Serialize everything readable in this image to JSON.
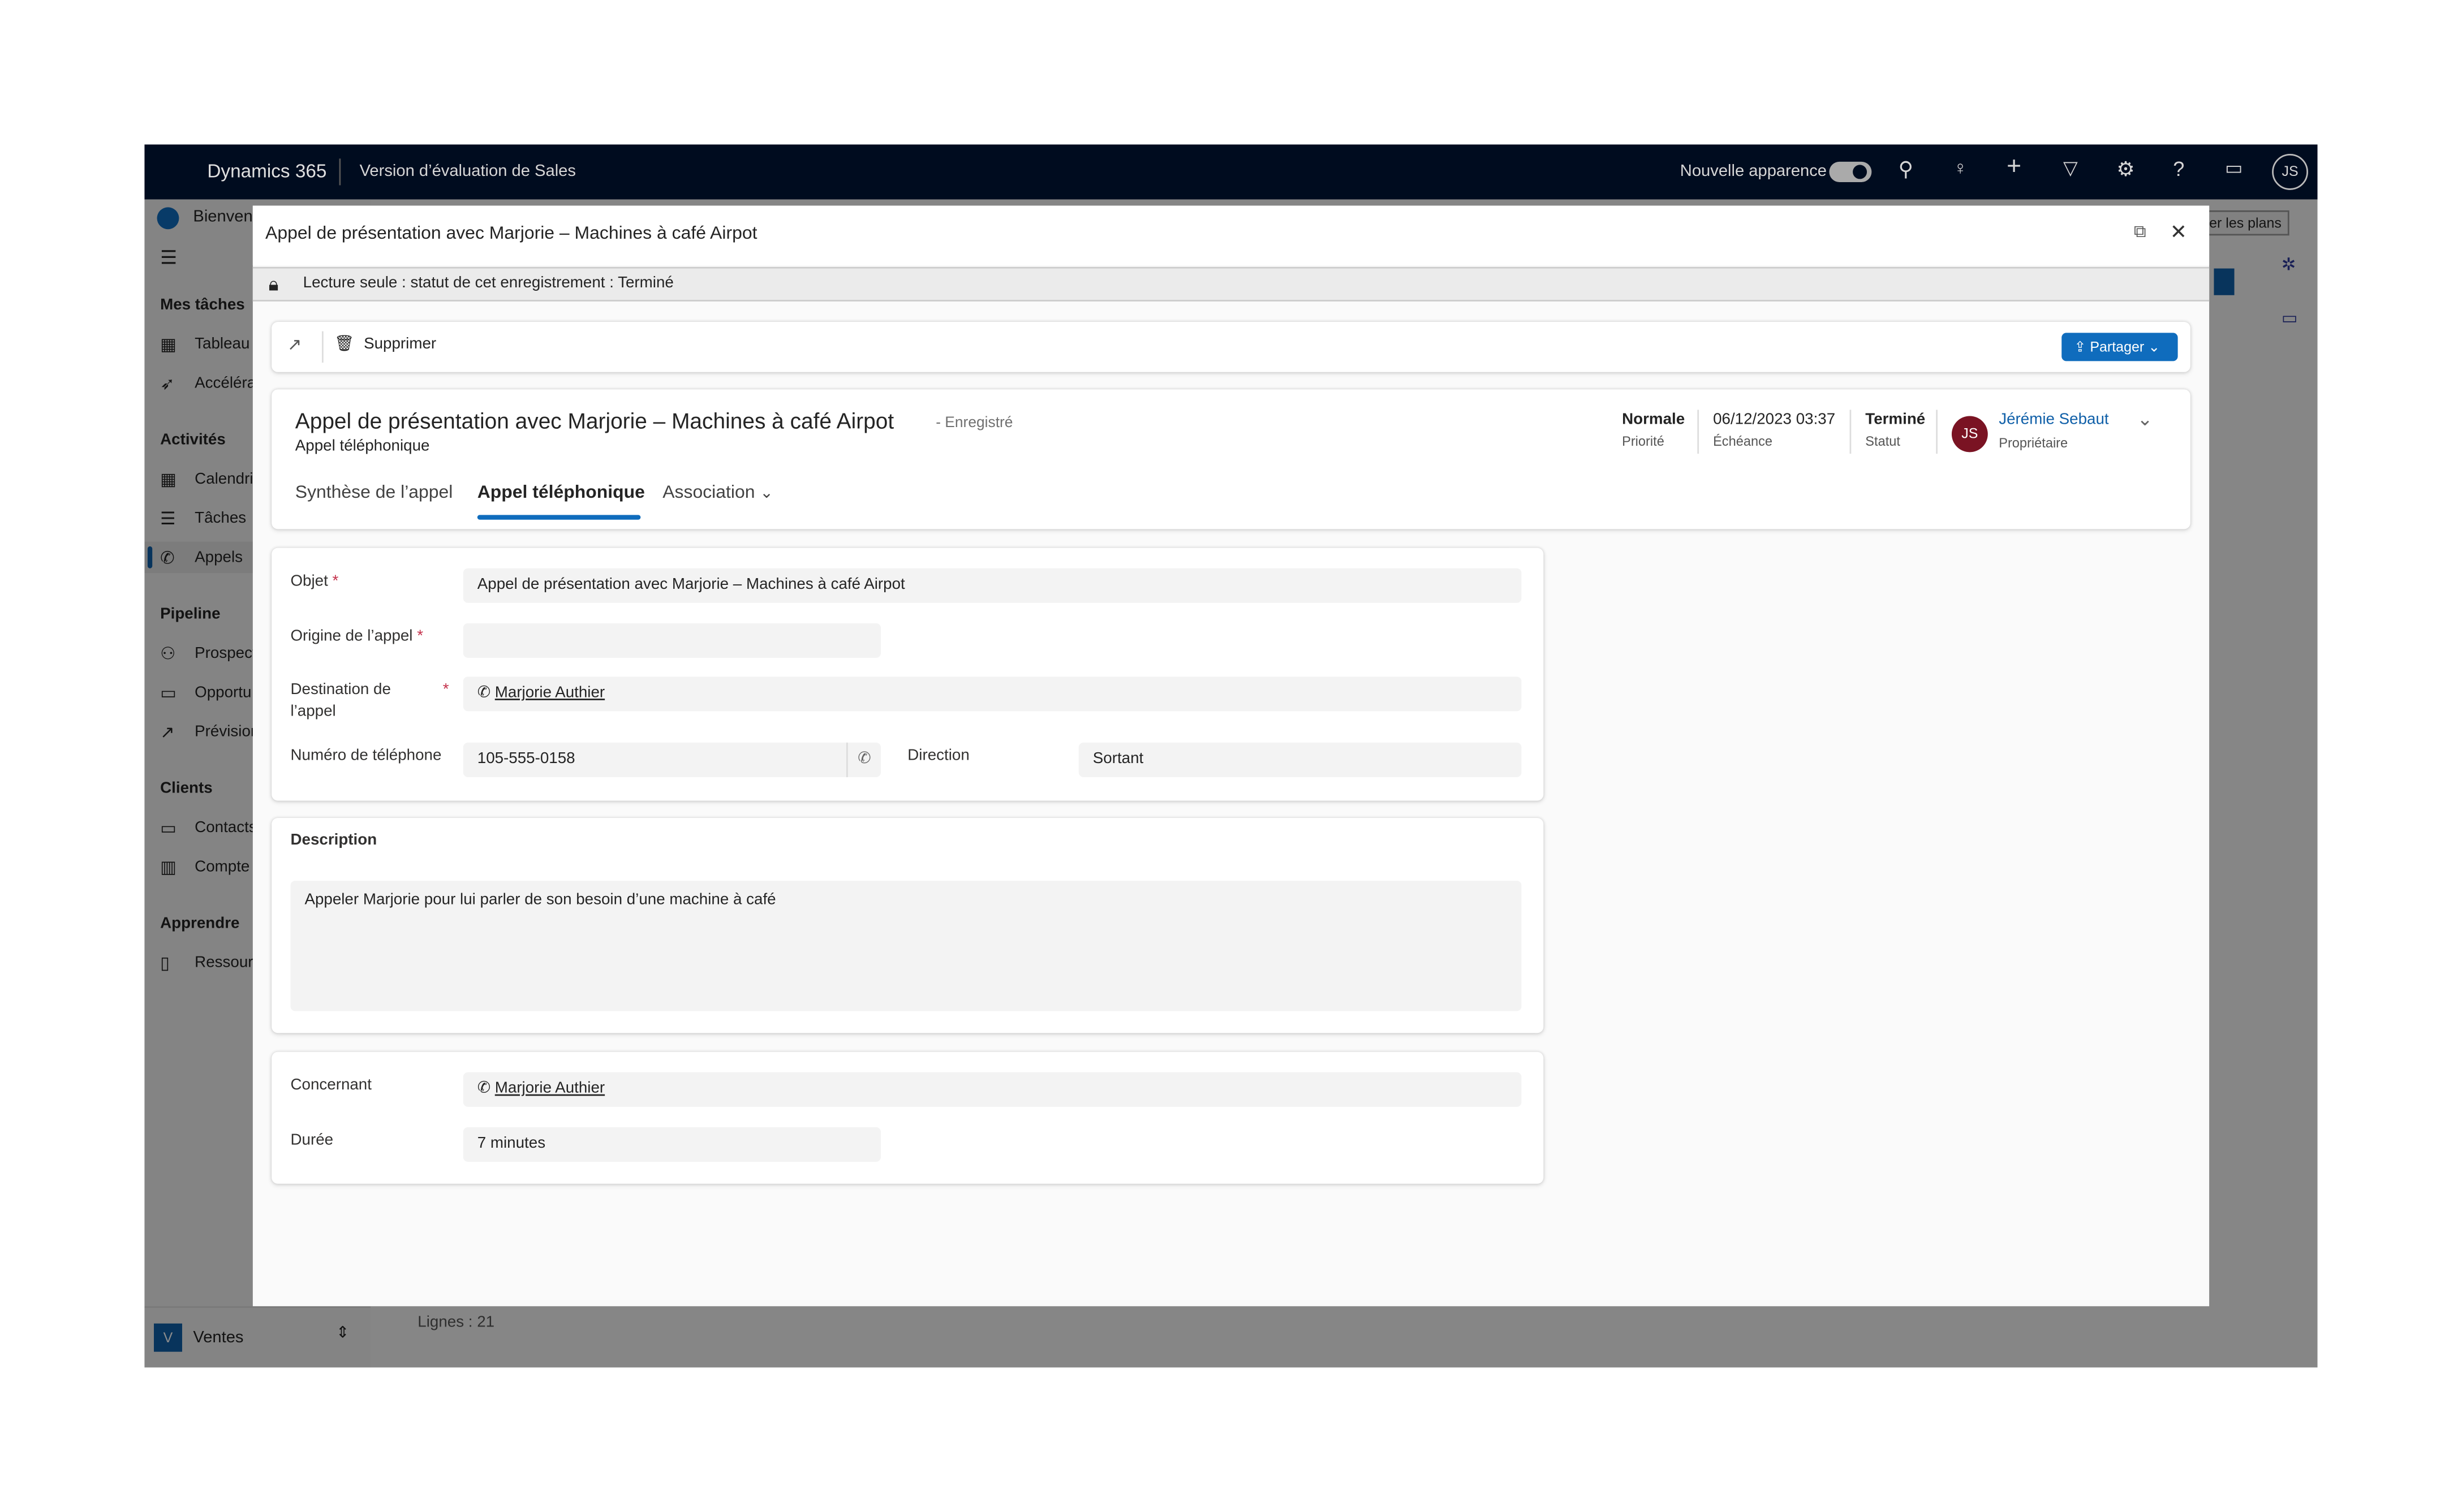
{
  "topbar": {
    "brand": "Dynamics 365",
    "app_name": "Version d’évaluation de Sales",
    "new_look_label": "Nouvelle apparence",
    "new_look_on": true,
    "user_initials": "JS",
    "icons": [
      "search-icon",
      "lightbulb-icon",
      "plus-icon",
      "filter-icon",
      "gear-icon",
      "help-icon",
      "chat-icon"
    ]
  },
  "background": {
    "welcome": "Bienven",
    "plans_button": "er les plans",
    "rows_count": "Lignes : 21"
  },
  "sidebar": {
    "groups": [
      {
        "title": "Mes tâches",
        "items": [
          {
            "label": "Tableau",
            "icon": "dashboard-icon"
          },
          {
            "label": "Accéléra",
            "icon": "rocket-icon"
          }
        ]
      },
      {
        "title": "Activités",
        "items": [
          {
            "label": "Calendri",
            "icon": "calendar-icon"
          },
          {
            "label": "Tâches",
            "icon": "tasks-icon"
          },
          {
            "label": "Appels",
            "icon": "phone-icon",
            "active": true
          }
        ]
      },
      {
        "title": "Pipeline",
        "items": [
          {
            "label": "Prospect",
            "icon": "people-icon"
          },
          {
            "label": "Opportu",
            "icon": "briefcase-icon"
          },
          {
            "label": "Prévision",
            "icon": "trend-icon"
          }
        ]
      },
      {
        "title": "Clients",
        "items": [
          {
            "label": "Contacts",
            "icon": "contact-card-icon"
          },
          {
            "label": "Compte",
            "icon": "building-icon"
          }
        ]
      },
      {
        "title": "Apprendre",
        "items": [
          {
            "label": "Ressourc",
            "icon": "book-icon"
          }
        ]
      }
    ],
    "area_initial": "V",
    "area_label": "Ventes"
  },
  "dialog": {
    "title": "Appel de présentation avec Marjorie – Machines à café Airpot",
    "readonly_notice": "Lecture seule : statut de cet enregistrement : Terminé",
    "commands": {
      "delete": "Supprimer",
      "share": "Partager"
    },
    "header": {
      "title": "Appel de présentation avec Marjorie – Machines à café Airpot",
      "save_state": "- Enregistré",
      "entity": "Appel téléphonique",
      "fields": [
        {
          "value": "Normale",
          "label": "Priorité"
        },
        {
          "value": "06/12/2023 03:37",
          "label": "Échéance"
        },
        {
          "value": "Terminé",
          "label": "Statut"
        }
      ],
      "owner": {
        "initials": "JS",
        "name": "Jérémie Sebaut",
        "label": "Propriétaire",
        "avatar_color": "#7a1323"
      }
    },
    "tabs": [
      {
        "label": "Synthèse de l’appel"
      },
      {
        "label": "Appel téléphonique",
        "active": true
      },
      {
        "label": "Association"
      }
    ],
    "form": {
      "subject": {
        "label": "Objet",
        "value": "Appel de présentation avec Marjorie – Machines à café Airpot"
      },
      "call_from": {
        "label": "Origine de l’appel",
        "value": ""
      },
      "call_to": {
        "label1": "Destination de",
        "label2": "l’appel",
        "value": "Marjorie Authier"
      },
      "phone": {
        "label": "Numéro de téléphone",
        "value": "105-555-0158"
      },
      "direction": {
        "label": "Direction",
        "value": "Sortant"
      },
      "description": {
        "label": "Description",
        "value": "Appeler Marjorie pour lui parler de son besoin d’une machine à café"
      },
      "regarding": {
        "label": "Concernant",
        "value": "Marjorie Authier"
      },
      "duration": {
        "label": "Durée",
        "value": "7 minutes"
      }
    }
  },
  "colors": {
    "accent": "#0f6cbd",
    "topbar": "#000c1f",
    "required": "#c4314b"
  }
}
